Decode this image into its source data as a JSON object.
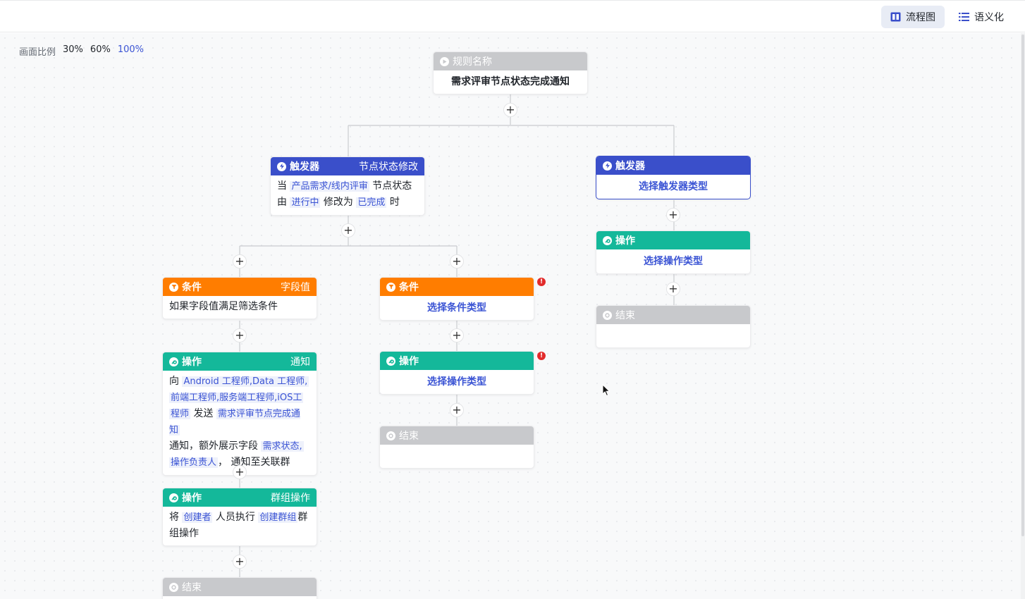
{
  "toolbar": {
    "flowchart_label": "流程图",
    "semantic_label": "语义化"
  },
  "zoom": {
    "label": "画面比例",
    "options": [
      "30%",
      "60%",
      "100%"
    ],
    "active": "100%"
  },
  "colors": {
    "trigger": "#3a4fca",
    "condition": "#ff7d00",
    "action": "#14b89a",
    "end": "#c8c9cc",
    "link": "#3b54d4"
  },
  "nodes": {
    "rule": {
      "header": "规则名称",
      "body": "需求评审节点状态完成通知"
    },
    "trigger_left": {
      "header": "触发器",
      "tag": "节点状态修改",
      "line1_pre": "当",
      "line1_hl": "产品需求/线内评审",
      "line1_post": "节点状态",
      "line2_pre": "由",
      "line2_hl1": "进行中",
      "line2_mid": "修改为",
      "line2_hl2": "已完成",
      "line2_post": "时"
    },
    "trigger_right": {
      "header": "触发器",
      "body": "选择触发器类型"
    },
    "action_right": {
      "header": "操作",
      "body": "选择操作类型"
    },
    "end_right": {
      "header": "结束"
    },
    "cond_left": {
      "header": "条件",
      "tag": "字段值",
      "body": "如果字段值满足筛选条件"
    },
    "cond_mid": {
      "header": "条件",
      "body": "选择条件类型"
    },
    "action_notify": {
      "header": "操作",
      "tag": "通知",
      "to": "向",
      "recipients1": "Android 工程师,Data 工程师,",
      "recipients2": "前端工程师,服务端工程师,iOS工",
      "recipients3": "程师",
      "send": "发送",
      "notice_name": "需求评审节点完成通知",
      "notice_word": "通知，额外展示字段",
      "fields1": "需求状态,",
      "fields2": "操作负责人",
      "tail": "， 通知至关联群"
    },
    "action_mid": {
      "header": "操作",
      "body": "选择操作类型"
    },
    "end_mid": {
      "header": "结束"
    },
    "action_group": {
      "header": "操作",
      "tag": "群组操作",
      "pre": "将",
      "hl1": "创建者",
      "mid": "人员执行",
      "hl2": "创建群组",
      "post": "群",
      "line2": "组操作"
    },
    "end_left": {
      "header": "结束"
    }
  },
  "plus_symbol": "+",
  "error_symbol": "!"
}
